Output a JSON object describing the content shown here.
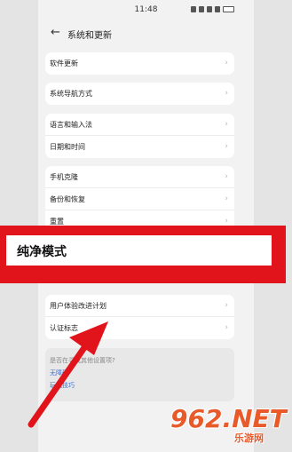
{
  "status_bar": {
    "time": "11:48"
  },
  "header": {
    "title": "系统和更新"
  },
  "groups": [
    {
      "items": [
        {
          "label": "软件更新"
        }
      ]
    },
    {
      "items": [
        {
          "label": "系统导航方式"
        }
      ]
    },
    {
      "items": [
        {
          "label": "语言和输入法"
        },
        {
          "label": "日期和时间"
        }
      ]
    },
    {
      "items": [
        {
          "label": "手机克隆"
        },
        {
          "label": "备份和恢复"
        },
        {
          "label": "重置"
        }
      ]
    },
    {
      "items": [
        {
          "label": "用户体验改进计划"
        },
        {
          "label": "认证标志"
        }
      ]
    }
  ],
  "info": {
    "question": "是否在寻找其他设置项?",
    "link1": "无障碍",
    "link2": "玩机技巧"
  },
  "highlight": {
    "label": "纯净模式",
    "color": "#e1141c"
  },
  "annotation": {
    "arrow_color": "#e1141c"
  },
  "watermark": {
    "logo": "962.NET",
    "sub": "乐游网"
  }
}
